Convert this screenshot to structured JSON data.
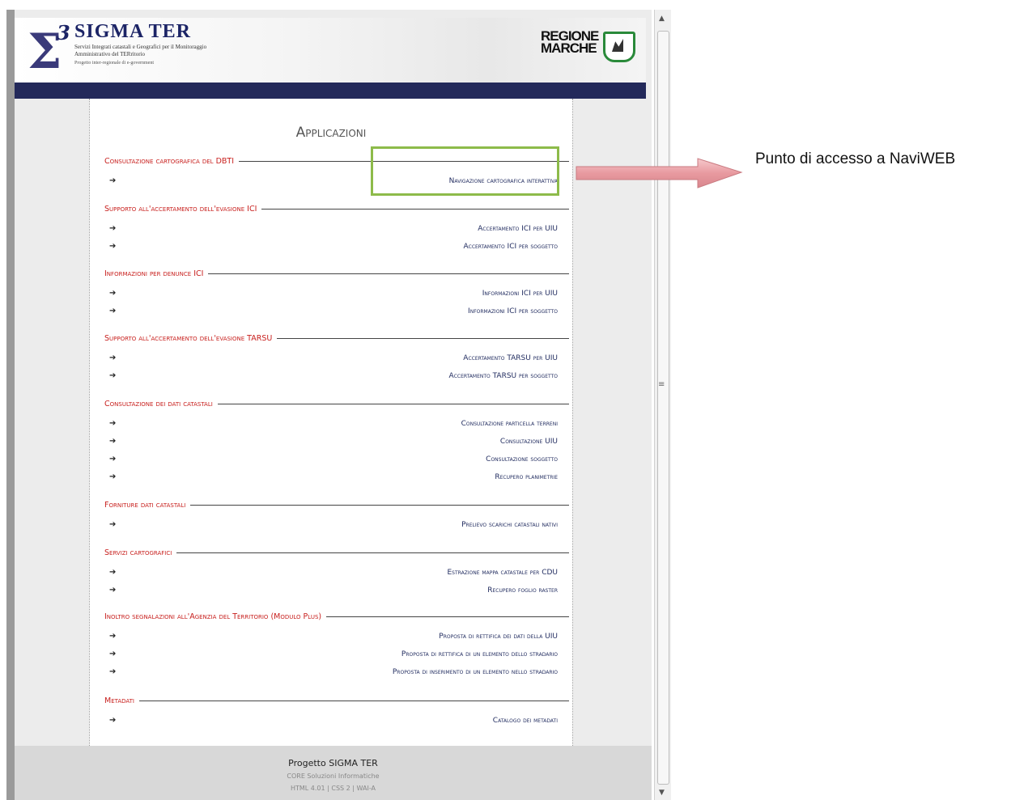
{
  "header": {
    "logo_mark": "Σ",
    "logo_sup": "3",
    "logo_title": "SIGMA TER",
    "logo_subtitle": "Servizi Integrati catastali e Geografici per il Monitoraggio Amministrativo del TERritorio",
    "logo_tagline": "Progetto inter-regionale di e-government",
    "region_line1": "REGIONE",
    "region_line2": "MARCHE"
  },
  "main": {
    "page_title": "Applicazioni",
    "sections": [
      {
        "title": "Consultazione cartografica del DBTI",
        "links": [
          "Navigazione cartografica interattiva"
        ]
      },
      {
        "title": "Supporto all'accertamento dell'evasione ICI",
        "links": [
          "Accertamento ICI per UIU",
          "Accertamento ICI per soggetto"
        ]
      },
      {
        "title": "Informazioni per denunce ICI",
        "links": [
          "Informazioni ICI per UIU",
          "Informazioni ICI per soggetto"
        ]
      },
      {
        "title": "Supporto all'accertamento dell'evasione TARSU",
        "links": [
          "Accertamento TARSU per UIU",
          "Accertamento TARSU per soggetto"
        ]
      },
      {
        "title": "Consultazione dei dati catastali",
        "links": [
          "Consultazione particella terreni",
          "Consultazione UIU",
          "Consultazione soggetto",
          "Recupero planimetrie"
        ]
      },
      {
        "title": "Forniture dati catastali",
        "links": [
          "Prelievo scarichi catastali nativi"
        ]
      },
      {
        "title": "Servizi cartografici",
        "links": [
          "Estrazione mappa catastale per CDU",
          "Recupero foglio raster"
        ]
      },
      {
        "title": "Inoltro segnalazioni all'Agenzia del Territorio (Modulo Plus)",
        "links": [
          "Proposta di rettifica dei dati della UIU",
          "Proposta di rettifica di un elemento dello stradario",
          "Proposta di inserimento di un elemento nello stradario"
        ]
      },
      {
        "title": "Metadati",
        "links": [
          "Catalogo dei metadati"
        ]
      }
    ],
    "arrow_glyph": "➔"
  },
  "footer": {
    "title": "Progetto SIGMA TER",
    "line1": "CORE Soluzioni Informatiche",
    "line2": "HTML 4.01 | CSS 2 | WAI-A"
  },
  "annotation": {
    "text": "Punto di accesso a NaviWEB",
    "highlight_color": "#8dbb4a",
    "arrow_color": "#e9a0a5"
  },
  "scrollbar": {
    "up": "▲",
    "down": "▼",
    "grip": "≡"
  }
}
